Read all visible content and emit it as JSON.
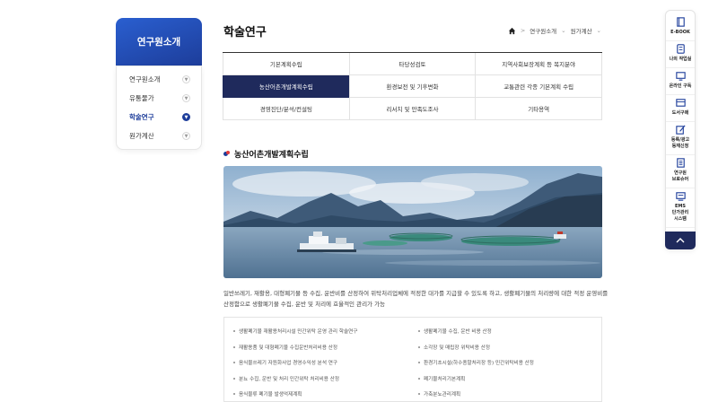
{
  "sidebar": {
    "title": "연구원소개",
    "items": [
      {
        "label": "연구원소개",
        "active": false
      },
      {
        "label": "유통물가",
        "active": false
      },
      {
        "label": "학술연구",
        "active": true
      },
      {
        "label": "원가계산",
        "active": false
      }
    ]
  },
  "page": {
    "title": "학술연구"
  },
  "breadcrumb": {
    "level1": "연구원소개",
    "level2": "원가계산"
  },
  "tabs": [
    [
      "기본계획수립",
      "타당성검토",
      "지역사회보장계획 등 복지분야"
    ],
    [
      "농산어촌개발계획수립",
      "환경보전 및 기후변화",
      "교통관련 각종 기본계획 수립"
    ],
    [
      "경영진단/분석/컨설팅",
      "리서치 및 만족도조사",
      "기타용역"
    ]
  ],
  "active_tab": "농산어촌개발계획수립",
  "section": {
    "title": "농산어촌개발계획수립",
    "description": "일반쓰레기, 재활용, 대형폐기물 등 수집, 운반비를 산정하여 위탁처리업체에 적정한 대가를 지급할 수 있도록 하고, 생활폐기물의 처리량에 대한 적정 운영비를 산정함으로 생활폐기물 수집, 운반 및 처리에 효율적인 관리가 가능",
    "list_left": [
      "생활폐기물 재활용처리시설 민간위탁 운영 관리 학술연구",
      "재활용품 및 대형폐기물 수집운반처리비용 산정",
      "음식물쓰레기 자원화사업 경영수익성 분석 연구",
      "분뇨 수집, 운반 및 처리 민간위탁 처리비용 산정",
      "음식물류 폐기물 발생억제계획"
    ],
    "list_right": [
      "생활폐기물 수집, 운반 비용 산정",
      "소각장 및 매립장 위탁비용 산정",
      "환경기초시설(하수종말처리장 등) 민간위탁비용 산정",
      "폐기물처리기본계획",
      "가축분뇨관리계획"
    ]
  },
  "quick_menu": [
    {
      "icon": "book-icon",
      "label": "E-BOOK"
    },
    {
      "icon": "document-icon",
      "label": "나의 작업실"
    },
    {
      "icon": "monitor-icon",
      "label": "온라인 구독"
    },
    {
      "icon": "cart-icon",
      "label": "도서구매"
    },
    {
      "icon": "edit-icon",
      "label": "등록/광고\n등재신청"
    },
    {
      "icon": "list-icon",
      "label": "연구원\n브로슈어"
    },
    {
      "icon": "server-icon",
      "label": "EMS\n단가관리\n시스템"
    }
  ],
  "colors": {
    "navy": "#1f2a5c",
    "accent_blue": "#1d3d9a",
    "accent_red": "#e23b3b"
  }
}
